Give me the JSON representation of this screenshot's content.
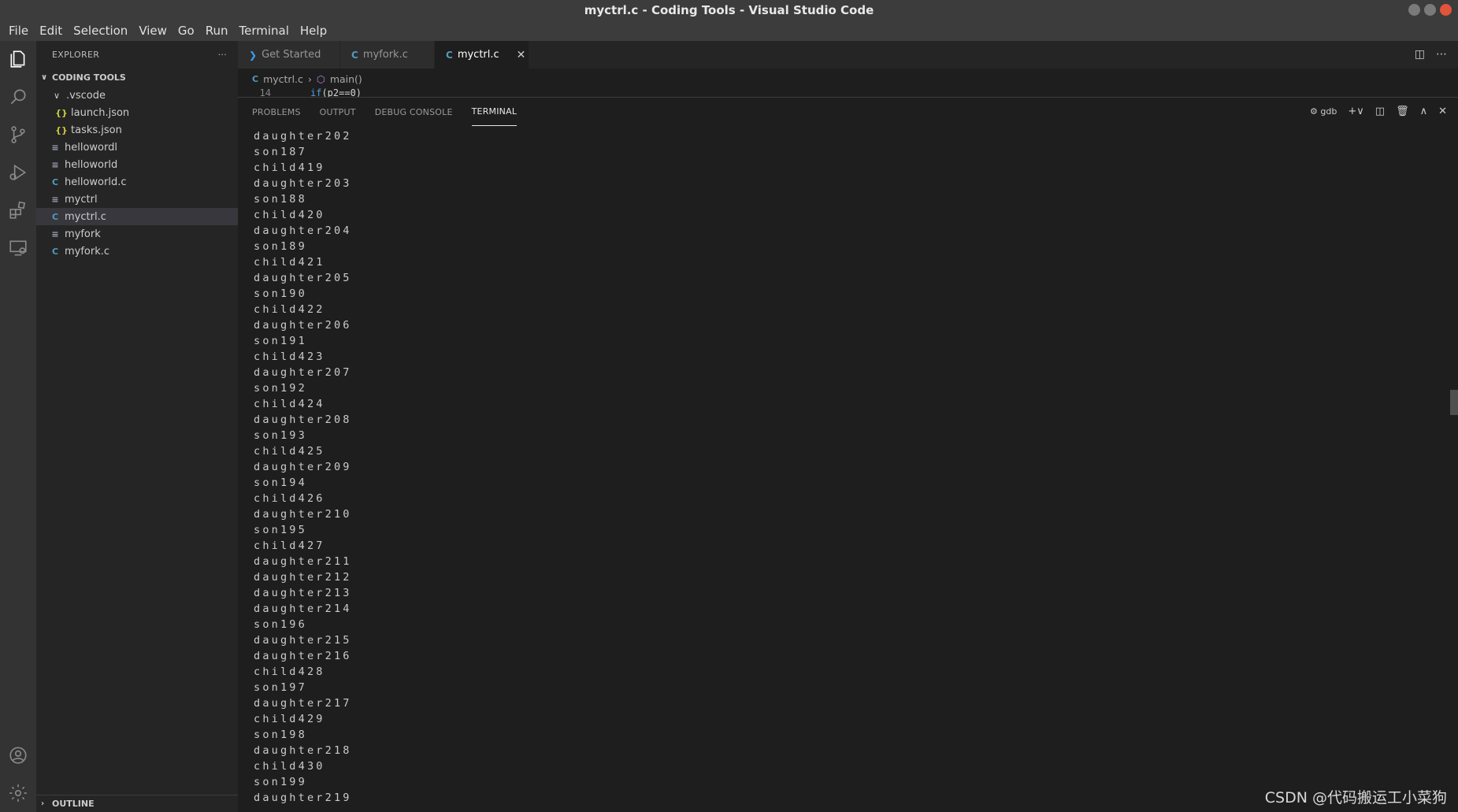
{
  "window": {
    "title": "myctrl.c - Coding Tools - Visual Studio Code"
  },
  "menu": [
    "File",
    "Edit",
    "Selection",
    "View",
    "Go",
    "Run",
    "Terminal",
    "Help"
  ],
  "activity_bar": [
    "files-icon",
    "search-icon",
    "source-control-icon",
    "run-debug-icon",
    "extensions-icon",
    "remote-explorer-icon",
    "account-icon",
    "settings-gear-icon"
  ],
  "sidebar": {
    "header": "EXPLORER",
    "more": "···",
    "section": "CODING TOOLS",
    "items": [
      {
        "label": ".vscode",
        "icon": "chevron-down-icon",
        "indent": 1
      },
      {
        "label": "launch.json",
        "icon": "json-icon",
        "indent": 2
      },
      {
        "label": "tasks.json",
        "icon": "json-icon",
        "indent": 2
      },
      {
        "label": "hellowordl",
        "icon": "text-file-icon",
        "indent": 1
      },
      {
        "label": "helloworld",
        "icon": "text-file-icon",
        "indent": 1
      },
      {
        "label": "helloworld.c",
        "icon": "c-file-icon",
        "indent": 1
      },
      {
        "label": "myctrl",
        "icon": "text-file-icon",
        "indent": 1
      },
      {
        "label": "myctrl.c",
        "icon": "c-file-icon",
        "indent": 1,
        "selected": true
      },
      {
        "label": "myfork",
        "icon": "text-file-icon",
        "indent": 1
      },
      {
        "label": "myfork.c",
        "icon": "c-file-icon",
        "indent": 1
      }
    ],
    "outline": "OUTLINE"
  },
  "tabs": [
    {
      "label": "Get Started",
      "icon": "vscode-icon"
    },
    {
      "label": "myfork.c",
      "icon": "c-file-icon"
    },
    {
      "label": "myctrl.c",
      "icon": "c-file-icon",
      "active": true
    }
  ],
  "breadcrumb": {
    "file": "myctrl.c",
    "symbol": "main()"
  },
  "code": {
    "line_number": "14",
    "keyword": "if",
    "rest": "(p2==0)"
  },
  "panel": {
    "tabs": [
      "PROBLEMS",
      "OUTPUT",
      "DEBUG CONSOLE",
      "TERMINAL"
    ],
    "active_tab": "TERMINAL",
    "terminal_name": "gdb",
    "lines": [
      "daughter202",
      "son187",
      "child419",
      "daughter203",
      "son188",
      "child420",
      "daughter204",
      "son189",
      "child421",
      "daughter205",
      "son190",
      "child422",
      "daughter206",
      "son191",
      "child423",
      "daughter207",
      "son192",
      "child424",
      "daughter208",
      "son193",
      "child425",
      "daughter209",
      "son194",
      "child426",
      "daughter210",
      "son195",
      "child427",
      "daughter211",
      "daughter212",
      "daughter213",
      "daughter214",
      "son196",
      "daughter215",
      "daughter216",
      "child428",
      "son197",
      "daughter217",
      "child429",
      "son198",
      "daughter218",
      "child430",
      "son199",
      "daughter219"
    ]
  },
  "watermark": "CSDN @代码搬运工小菜狗",
  "colors": {
    "accent_c": "#519aba",
    "json": "#cbcb41",
    "close_red": "#e0543b"
  }
}
